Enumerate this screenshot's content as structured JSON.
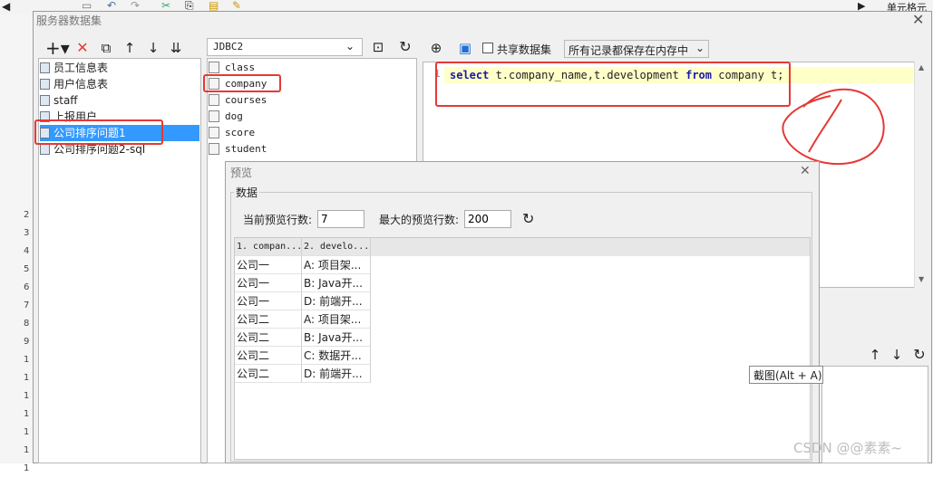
{
  "background": {
    "cell_header": "单元格元",
    "row_numbers": [
      "2",
      "3",
      "4",
      "5",
      "6",
      "7",
      "8",
      "9",
      "1",
      "1",
      "1",
      "1",
      "1",
      "1",
      "1"
    ]
  },
  "dialog": {
    "title": "服务器数据集",
    "datasets": [
      "员工信息表",
      "用户信息表",
      "staff",
      "上报用户",
      "公司排序问题1",
      "公司排序问题2-sql"
    ],
    "selected_dataset": "公司排序问题1"
  },
  "connection": {
    "name": "JDBC2"
  },
  "tables": [
    "class",
    "company",
    "courses",
    "dog",
    "score",
    "student"
  ],
  "editor": {
    "shared_label": "共享数据集",
    "storage_option": "所有记录都保存在内存中",
    "line_number": "1",
    "sql": {
      "kw1": "select",
      "mid": " t.company_name,t.development ",
      "kw2": "from",
      "tail": " company t;"
    }
  },
  "preview": {
    "title": "预览",
    "group_label": "数据",
    "current_rows_label": "当前预览行数:",
    "current_rows_value": "7",
    "max_rows_label": "最大的预览行数:",
    "max_rows_value": "200",
    "columns": [
      "1. compan...",
      "2. develo..."
    ],
    "rows": [
      [
        "公司一",
        "A: 项目架..."
      ],
      [
        "公司一",
        "B: Java开..."
      ],
      [
        "公司一",
        "D: 前端开..."
      ],
      [
        "公司二",
        "A: 项目架..."
      ],
      [
        "公司二",
        "B: Java开..."
      ],
      [
        "公司二",
        "C: 数据开..."
      ],
      [
        "公司二",
        "D: 前端开..."
      ]
    ]
  },
  "tooltip": "截图(Alt + A)",
  "watermark": "CSDN @@素素~",
  "colors": {
    "selection": "#3399ff",
    "annotation_red": "#e53935",
    "sql_keyword": "#1a1aa6",
    "highlight_line": "#ffffc8"
  }
}
